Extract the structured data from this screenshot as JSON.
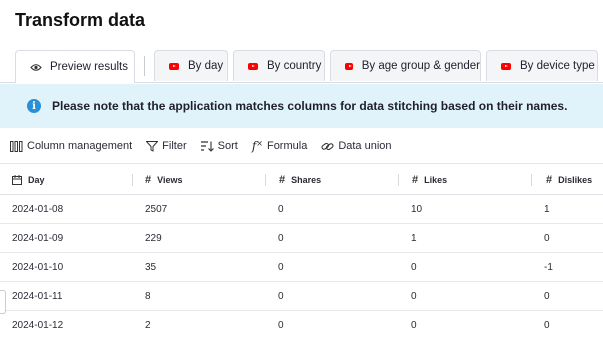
{
  "header": {
    "title": "Transform data"
  },
  "tabs": [
    {
      "label": "Preview results",
      "icon": "eye-icon"
    },
    {
      "label": "By day",
      "icon": "youtube-icon"
    },
    {
      "label": "By country",
      "icon": "youtube-icon"
    },
    {
      "label": "By age group & gender",
      "icon": "youtube-icon"
    },
    {
      "label": "By device type",
      "icon": "youtube-icon"
    }
  ],
  "banner": {
    "text": "Please note that the application matches columns for data stitching based on their names.",
    "icon": "info-icon"
  },
  "toolbar": {
    "column_management": "Column management",
    "filter": "Filter",
    "sort": "Sort",
    "formula": "Formula",
    "data_union": "Data union"
  },
  "table": {
    "columns": [
      "Day",
      "Views",
      "Shares",
      "Likes",
      "Dislikes"
    ],
    "rows": [
      [
        "2024-01-08",
        "2507",
        "0",
        "10",
        "1"
      ],
      [
        "2024-01-09",
        "229",
        "0",
        "1",
        "0"
      ],
      [
        "2024-01-10",
        "35",
        "0",
        "0",
        "-1"
      ],
      [
        "2024-01-11",
        "8",
        "0",
        "0",
        "0"
      ],
      [
        "2024-01-12",
        "2",
        "0",
        "0",
        "0"
      ]
    ]
  },
  "colors": {
    "banner_bg": "#e0f3fb",
    "info_icon": "#2b8fd6",
    "youtube": "#ff0000"
  }
}
